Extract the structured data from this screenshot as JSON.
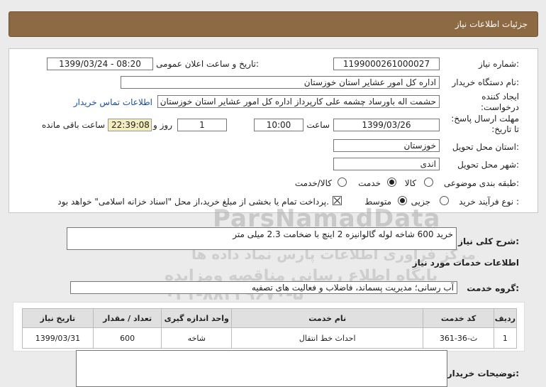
{
  "header": {
    "title": "جزئیات اطلاعات نیاز"
  },
  "form": {
    "need_number_label": "شماره نیاز:",
    "need_number": "1199000261000027",
    "announce_label": "تاریخ و ساعت اعلان عمومی:",
    "announce_value": "1399/03/24 - 08:20",
    "buyer_org_label": "نام دستگاه خریدار:",
    "buyer_org": "اداره کل امور عشایر استان خوزستان",
    "creator_label": "ایجاد کننده درخواست:",
    "creator": "حشمت اله باورساد چشمه علی کارپرداز اداره کل امور عشایر استان خوزستان",
    "contact_link": "اطلاعات تماس خریدار",
    "deadline_label": "مهلت ارسال پاسخ: تا تاریخ:",
    "deadline_date": "1399/03/26",
    "time_label": "ساعت",
    "deadline_time": "10:00",
    "days_value": "1",
    "days_label": "روز و",
    "remaining_time": "22:39:08",
    "remaining_label": "ساعت باقی مانده",
    "province_label": "استان محل تحویل:",
    "province": "خوزستان",
    "city_label": "شهر محل تحویل:",
    "city": "اندی",
    "category_label": "طبقه بندی موضوعی:",
    "category_options": [
      "کالا",
      "خدمت",
      "کالا/خدمت"
    ],
    "category_selected": "خدمت",
    "purchase_label": "نوع فرآیند خرید :",
    "purchase_options": [
      "جزیی",
      "متوسط"
    ],
    "purchase_selected": "متوسط",
    "payment_note": "پرداخت تمام یا بخشی از مبلغ خرید،از محل \"اسناد خزانه اسلامی\" خواهد بود."
  },
  "summary": {
    "label": "شرح کلی نیاز:",
    "text": "خرید 600 شاخه لوله گالوانیزه  2 اینچ با ضخامت 2.3 میلی متر"
  },
  "services": {
    "section_title": "اطلاعات خدمات مورد نیاز",
    "group_label": "گروه خدمت:",
    "group_value": "آب رسانی؛ مدیریت پسماند، فاضلاب و فعالیت های تصفیه",
    "columns": [
      "ردیف",
      "کد خدمت",
      "نام خدمت",
      "واحد اندازه گیری",
      "تعداد / مقدار",
      "تاریخ نیاز"
    ],
    "rows": [
      [
        "1",
        "ث-36-361",
        "احداث خط انتقال",
        "شاخه",
        "600",
        "1399/03/31"
      ]
    ]
  },
  "buyer_notes": {
    "label": "توضیحات خریدار:"
  },
  "watermark": {
    "brand": "ParsNamadData",
    "line1": "مرکز فراوری اطلاعات پارس نماد داده ها",
    "line2": "پایگاه اطلاع رسانی مناقصه ومزایده",
    "phone": "۰۲۱-۸۸۳۴۹۶۷۰-۵"
  }
}
